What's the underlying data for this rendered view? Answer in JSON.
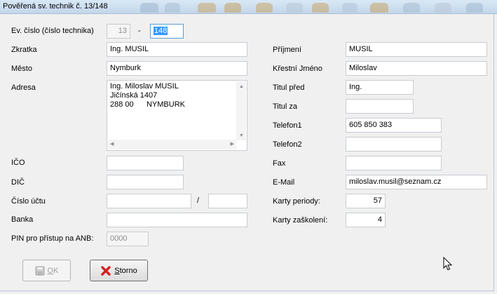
{
  "window": {
    "title": "Pověřená sv. technik č. 13/148"
  },
  "form": {
    "ev_cislo": {
      "label": "Ev. číslo (číslo technika)",
      "prefix": "13",
      "separator": "-",
      "value": "148"
    },
    "zkratka": {
      "label": "Zkratka",
      "value": "Ing. MUSIL"
    },
    "mesto": {
      "label": "Město",
      "value": "Nymburk"
    },
    "adresa": {
      "label": "Adresa",
      "lines": [
        "Ing. Miloslav MUSIL",
        "Jičínská 1407",
        "288 00      NYMBURK"
      ]
    },
    "ico": {
      "label": "IČO",
      "value": ""
    },
    "dic": {
      "label": "DIČ",
      "value": ""
    },
    "cislo_uctu": {
      "label": "Číslo účtu",
      "value": "",
      "separator": "/",
      "bank_code": ""
    },
    "banka": {
      "label": "Banka",
      "value": ""
    },
    "pin": {
      "label": "PIN pro přístup na ANB:",
      "value": "0000"
    },
    "prijmeni": {
      "label": "Příjmení",
      "value": "MUSIL"
    },
    "krestni_jmeno": {
      "label": "Křestní Jméno",
      "value": "Miloslav"
    },
    "titul_pred": {
      "label": "Titul před",
      "value": "Ing."
    },
    "titul_za": {
      "label": "Titul za",
      "value": ""
    },
    "telefon1": {
      "label": "Telefon1",
      "value": "605 850 383"
    },
    "telefon2": {
      "label": "Telefon2",
      "value": ""
    },
    "fax": {
      "label": "Fax",
      "value": ""
    },
    "email": {
      "label": "E-Mail",
      "value": "miloslav.musil@seznam.cz"
    },
    "karty_periody": {
      "label": "Karty periody:",
      "value": "57"
    },
    "karty_zaskoleni": {
      "label": "Karty zaškolení:",
      "value": "4"
    }
  },
  "buttons": {
    "ok": {
      "label_underlined": "O",
      "label_rest": "K",
      "icon": "floppy-disk-icon",
      "enabled": false
    },
    "storno": {
      "label_underlined": "S",
      "label_rest": "torno",
      "icon": "red-x-icon",
      "enabled": true
    }
  }
}
